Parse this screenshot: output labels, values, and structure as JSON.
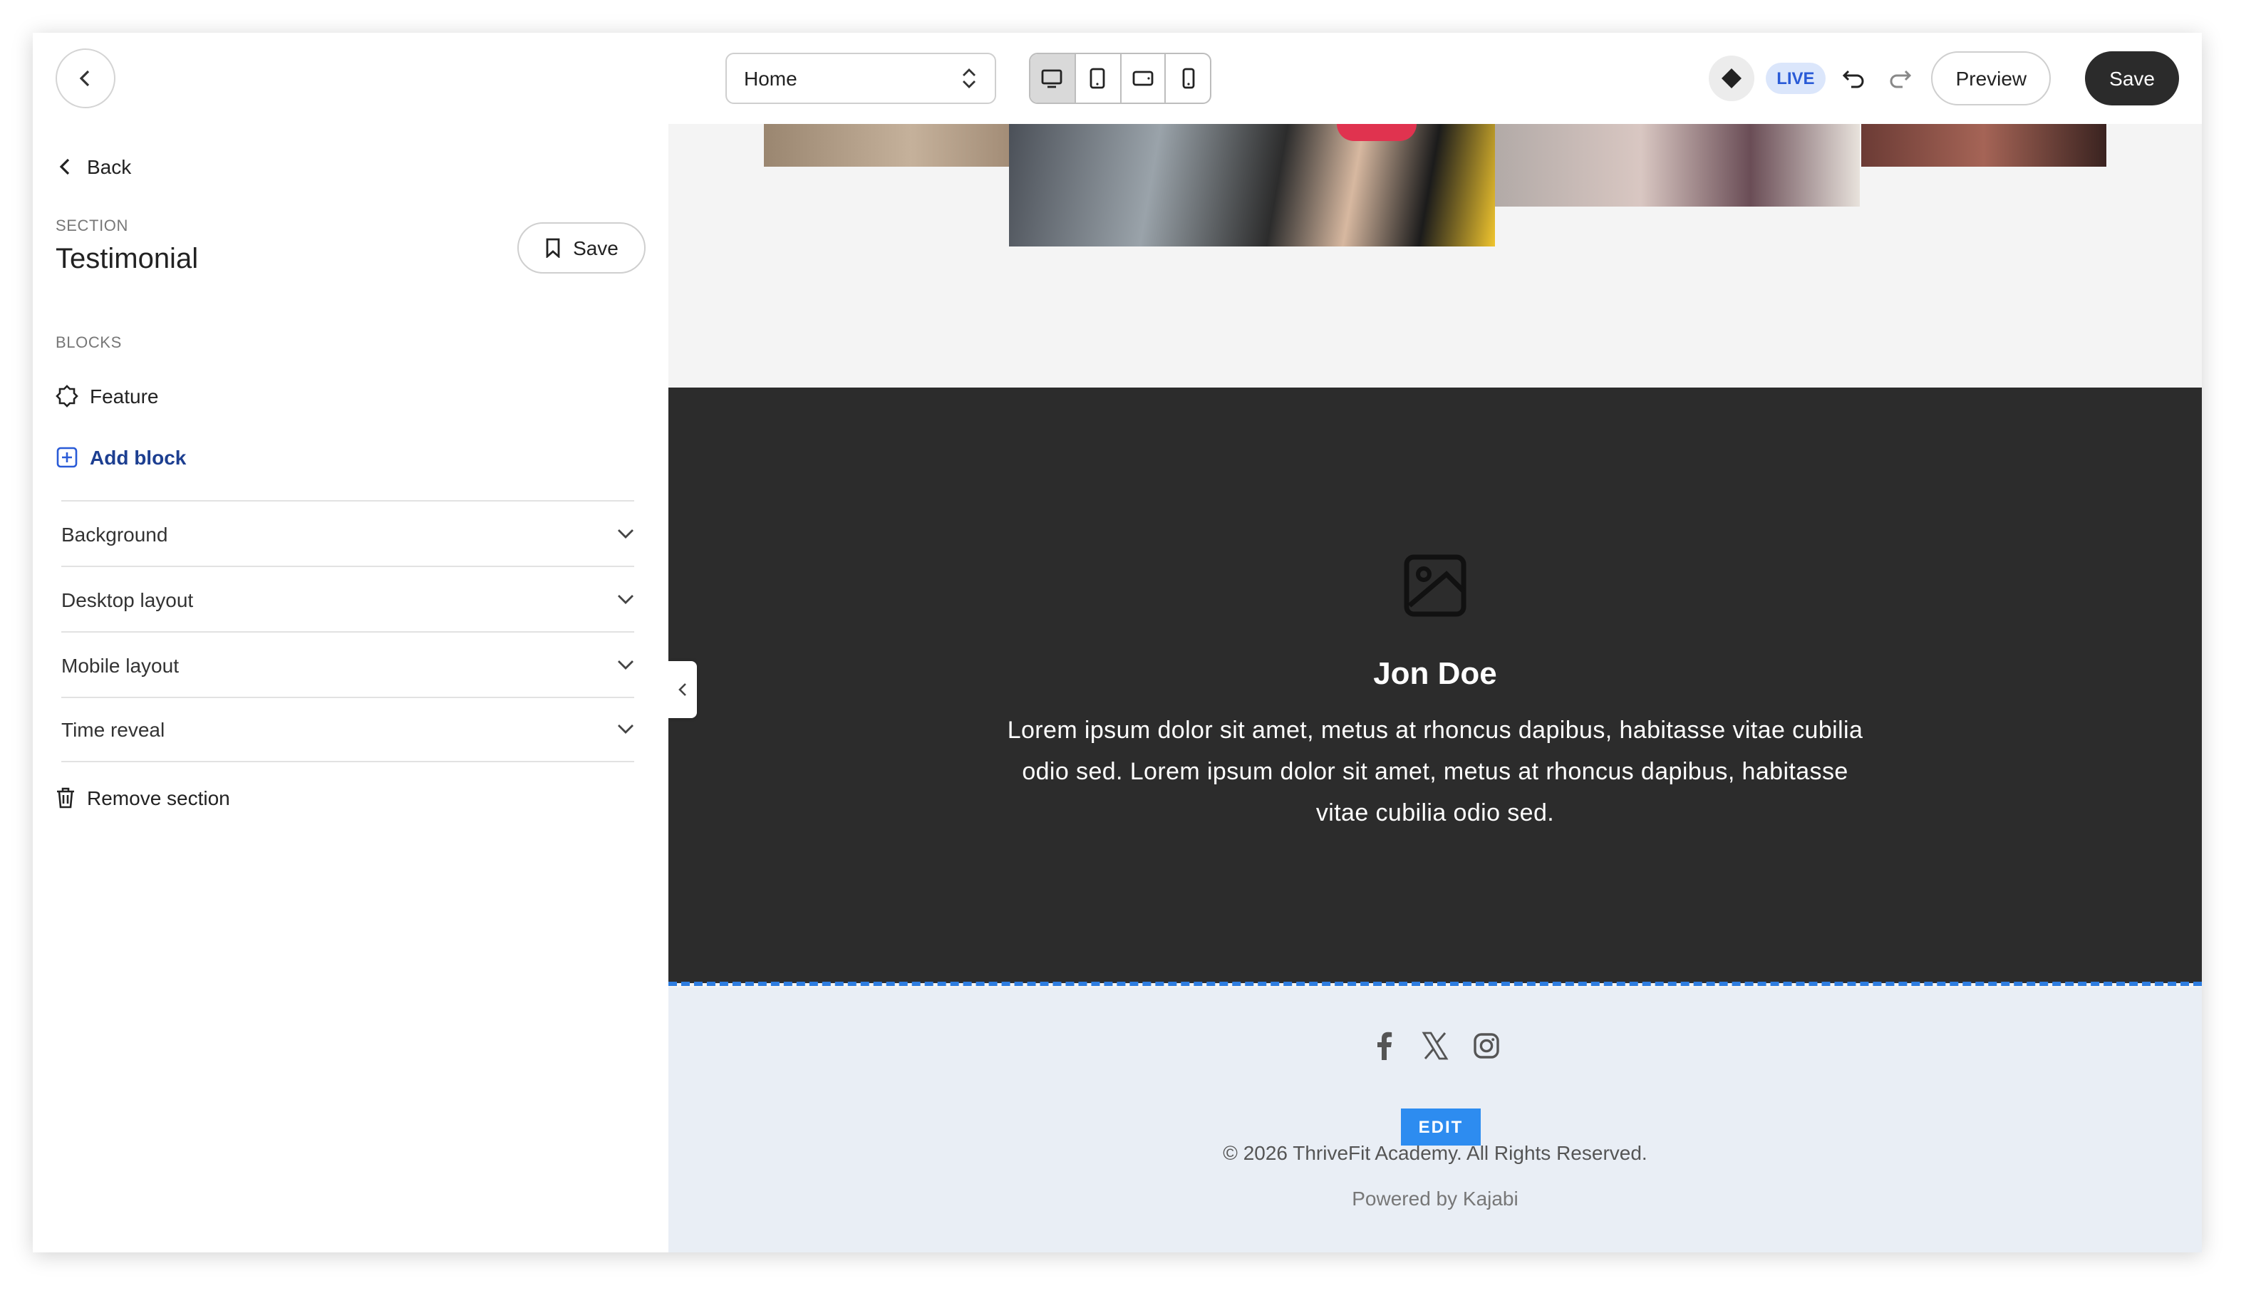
{
  "topbar": {
    "page_select": "Home",
    "live_badge": "LIVE",
    "preview_label": "Preview",
    "save_label": "Save"
  },
  "sidebar": {
    "back_label": "Back",
    "section_label": "SECTION",
    "section_title": "Testimonial",
    "save_label": "Save",
    "blocks_label": "BLOCKS",
    "block_feature": "Feature",
    "add_block": "Add block",
    "accordion": [
      "Background",
      "Desktop layout",
      "Mobile layout",
      "Time reveal"
    ],
    "remove_section": "Remove section"
  },
  "testimonial": {
    "name": "Jon Doe",
    "quote": "Lorem ipsum dolor sit amet, metus at rhoncus dapibus, habitasse vitae cubilia odio sed. Lorem ipsum dolor sit amet, metus at rhoncus dapibus, habitasse vitae cubilia odio sed."
  },
  "footer": {
    "edit_badge": "EDIT",
    "copyright": "© 2026 ThriveFit Academy. All Rights Reserved.",
    "powered": "Powered by Kajabi",
    "social_icons": [
      "facebook-icon",
      "x-icon",
      "instagram-icon"
    ]
  },
  "colors": {
    "dark_section": "#2c2c2c",
    "footer_bg": "#e9eef5",
    "accent_blue": "#2d8cf0",
    "save_dark": "#2b2b2b"
  }
}
